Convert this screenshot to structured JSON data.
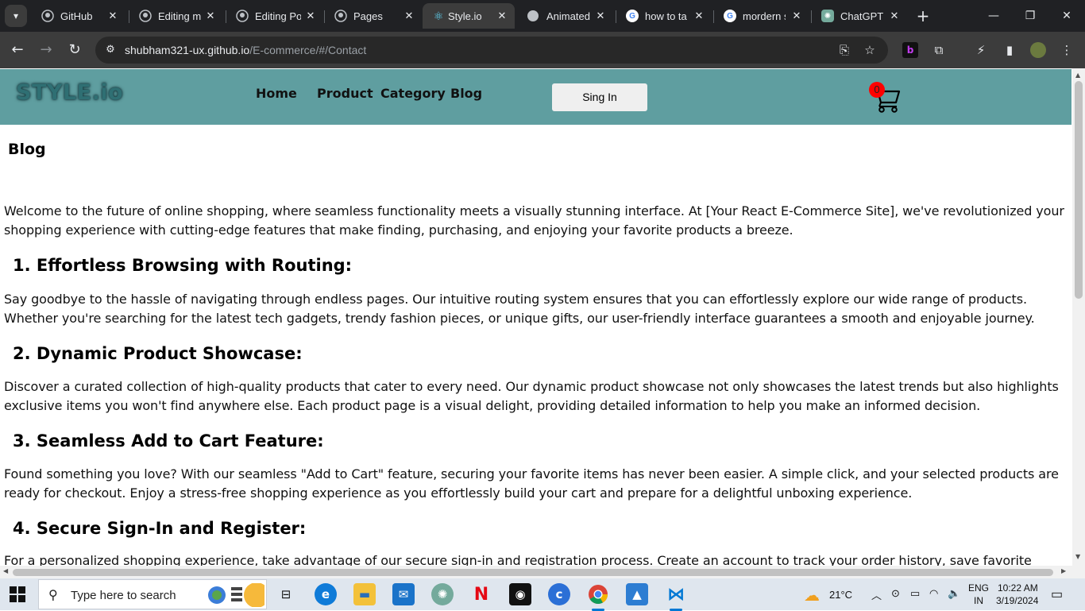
{
  "browser": {
    "tabs": [
      {
        "title": "GitHub",
        "icon": "github-icon"
      },
      {
        "title": "Editing m",
        "icon": "github-icon"
      },
      {
        "title": "Editing Po",
        "icon": "github-icon"
      },
      {
        "title": "Pages",
        "icon": "github-icon"
      },
      {
        "title": "Style.io",
        "icon": "react-icon",
        "active": true
      },
      {
        "title": "Animated",
        "icon": "codepen-icon"
      },
      {
        "title": "how to ta",
        "icon": "google-icon"
      },
      {
        "title": "mordern s",
        "icon": "google-icon"
      },
      {
        "title": "ChatGPT",
        "icon": "chatgpt-icon"
      }
    ],
    "url_host": "shubham321-ux.github.io",
    "url_path": "/E-commerce/#/Contact"
  },
  "site": {
    "logo": "STYLE.io",
    "nav": [
      "Home",
      "Product",
      "Category",
      "Blog"
    ],
    "signin_label": "Sing In",
    "cart_count": "0",
    "header_color": "#5f9ea0"
  },
  "blog": {
    "title": "Blog",
    "intro": "Welcome to the future of online shopping, where seamless functionality meets a visually stunning interface. At [Your React E-Commerce Site], we've revolutionized your shopping experience with cutting-edge features that make finding, purchasing, and enjoying your favorite products a breeze.",
    "sections": [
      {
        "heading": "1. Effortless Browsing with Routing:",
        "body": "Say goodbye to the hassle of navigating through endless pages. Our intuitive routing system ensures that you can effortlessly explore our wide range of products. Whether you're searching for the latest tech gadgets, trendy fashion pieces, or unique gifts, our user-friendly interface guarantees a smooth and enjoyable journey."
      },
      {
        "heading": "2. Dynamic Product Showcase:",
        "body": "Discover a curated collection of high-quality products that cater to every need. Our dynamic product showcase not only showcases the latest trends but also highlights exclusive items you won't find anywhere else. Each product page is a visual delight, providing detailed information to help you make an informed decision."
      },
      {
        "heading": "3. Seamless Add to Cart Feature:",
        "body": "Found something you love? With our seamless \"Add to Cart\" feature, securing your favorite items has never been easier. A simple click, and your selected products are ready for checkout. Enjoy a stress-free shopping experience as you effortlessly build your cart and prepare for a delightful unboxing experience."
      },
      {
        "heading": "4. Secure Sign-In and Register:",
        "body": "For a personalized shopping experience, take advantage of our secure sign-in and registration process. Create an account to track your order history, save favorite items, and enjoy exclusive offers."
      }
    ]
  },
  "taskbar": {
    "search_placeholder": "Type here to search",
    "weather": "21°C",
    "lang_top": "ENG",
    "lang_bottom": "IN",
    "time": "10:22 AM",
    "date": "3/19/2024"
  }
}
